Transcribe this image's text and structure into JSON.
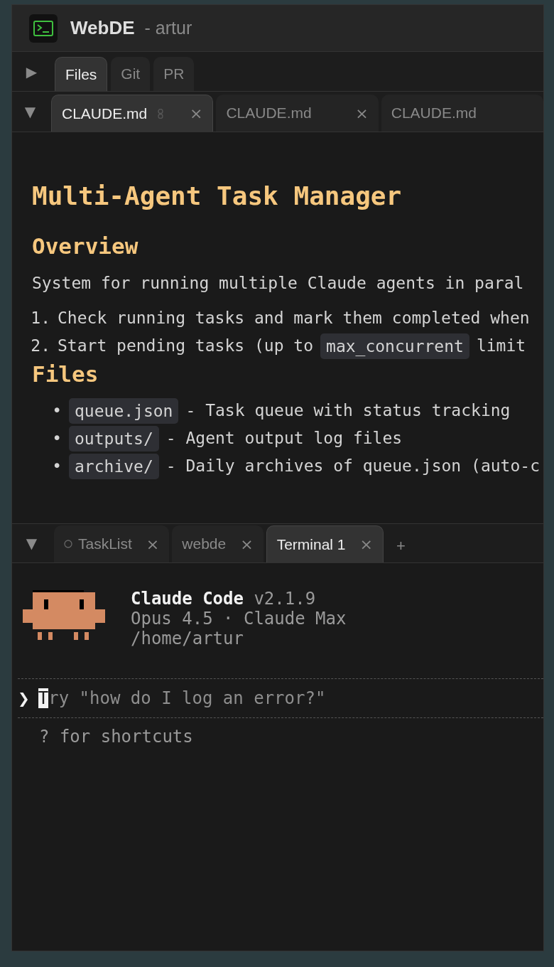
{
  "window": {
    "app_name": "WebDE",
    "subtitle": "- artur"
  },
  "sidebar_tabs": {
    "toggle": "▶",
    "tabs": [
      {
        "label": "Files",
        "selected": true
      },
      {
        "label": "Git",
        "selected": false
      },
      {
        "label": "PR",
        "selected": false
      }
    ]
  },
  "editor_tabs": {
    "toggle": "▼",
    "tabs": [
      {
        "label": "CLAUDE.md",
        "selected": true,
        "linked": true,
        "close": "×"
      },
      {
        "label": "CLAUDE.md",
        "selected": false,
        "linked": false,
        "close": "×"
      },
      {
        "label": "CLAUDE.md",
        "selected": false,
        "linked": false
      }
    ]
  },
  "document": {
    "title": "Multi-Agent Task Manager",
    "sections": [
      {
        "heading": "Overview",
        "blocks": [
          {
            "kind": "paragraph",
            "parts": [
              {
                "kind": "text",
                "text": "System for running multiple Claude agents in paral"
              }
            ]
          },
          {
            "kind": "ordered_item",
            "marker": "1.",
            "parts": [
              {
                "kind": "text",
                "text": "Check running tasks and mark them completed when"
              }
            ]
          },
          {
            "kind": "ordered_item",
            "marker": "2.",
            "parts": [
              {
                "kind": "text",
                "text": "Start pending tasks (up to"
              },
              {
                "kind": "code",
                "text": "max_concurrent"
              },
              {
                "kind": "text",
                "text": "limit"
              }
            ]
          }
        ]
      },
      {
        "heading": "Files",
        "blocks": [
          {
            "kind": "bullet_item",
            "marker": "•",
            "parts": [
              {
                "kind": "code",
                "text": "queue.json"
              },
              {
                "kind": "text",
                "text": "- Task queue with status tracking"
              }
            ]
          },
          {
            "kind": "bullet_item",
            "marker": "•",
            "parts": [
              {
                "kind": "code",
                "text": "outputs/"
              },
              {
                "kind": "text",
                "text": "- Agent output log files"
              }
            ]
          },
          {
            "kind": "bullet_item",
            "marker": "•",
            "parts": [
              {
                "kind": "code",
                "text": "archive/"
              },
              {
                "kind": "text",
                "text": "- Daily archives of queue.json (auto-c"
              }
            ]
          }
        ]
      }
    ]
  },
  "panel_tabs": {
    "toggle": "▼",
    "add": "+",
    "tabs": [
      {
        "label": "TaskList",
        "selected": false,
        "status_icon": true,
        "close": "×"
      },
      {
        "label": "webde",
        "selected": false,
        "status_icon": false,
        "close": "×"
      },
      {
        "label": "Terminal 1",
        "selected": true,
        "status_icon": false,
        "close": "×"
      }
    ]
  },
  "terminal": {
    "product": "Claude Code",
    "version": "v2.1.9",
    "plan": "Opus 4.5 · Claude Max",
    "cwd": "/home/artur",
    "prompt_symbol": "❯",
    "placeholder": "Try \"how do I log an error?\"",
    "hint": "? for shortcuts"
  }
}
